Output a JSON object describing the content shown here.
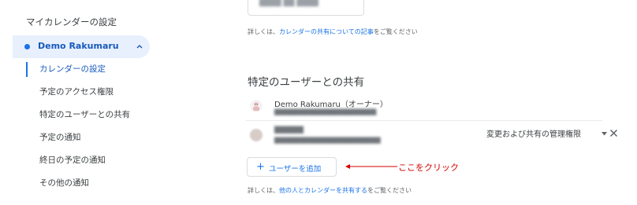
{
  "sidebar": {
    "title": "マイカレンダーの設定",
    "calendar": {
      "name": "Demo Rakumaru",
      "color": "#1a73e8"
    },
    "items": [
      {
        "label": "カレンダーの設定",
        "active": true
      },
      {
        "label": "予定のアクセス権限"
      },
      {
        "label": "特定のユーザーとの共有"
      },
      {
        "label": "予定の通知"
      },
      {
        "label": "終日の予定の通知"
      },
      {
        "label": "その他の通知"
      }
    ]
  },
  "main": {
    "top_info": {
      "prefix": "詳しくは、",
      "link": "カレンダーの共有についての記事",
      "suffix": "をご覧ください"
    },
    "section_title": "特定のユーザーとの共有",
    "owner": {
      "name": "Demo Rakumaru（オーナー）"
    },
    "shared_user": {
      "permission": "変更および共有の管理権限"
    },
    "add_user_label": "ユーザーを追加",
    "bottom_info": {
      "prefix": "詳しくは、",
      "link": "他の人とカレンダーを共有する",
      "suffix": "をご覧ください"
    },
    "annotation": "ここをクリック"
  },
  "colors": {
    "accent": "#1a73e8",
    "annotation": "#d50000",
    "selected_bg": "#e8f0fe"
  }
}
